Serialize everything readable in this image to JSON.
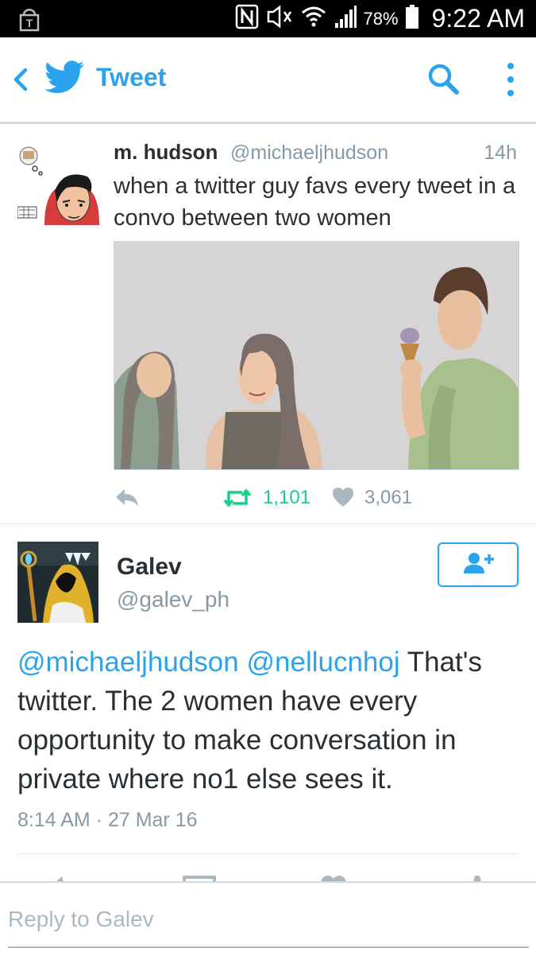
{
  "status_bar": {
    "battery_percent": "78%",
    "time": "9:22 AM",
    "icons": [
      "t-mobile-icon",
      "nfc-icon",
      "mute-icon",
      "wifi-icon",
      "signal-icon",
      "battery-icon"
    ]
  },
  "app_bar": {
    "title": "Tweet",
    "accent_color": "#2aa3ef",
    "icons": [
      "back-icon",
      "twitter-bird-icon",
      "search-icon",
      "more-icon"
    ]
  },
  "quoted_tweet": {
    "name": "m. hudson",
    "handle": "@michaeljhudson",
    "time": "14h",
    "text": "when a twitter guy favs every tweet in a convo between two women",
    "retweets": "1,101",
    "likes": "3,061",
    "retweet_color": "#19cf86"
  },
  "focused_tweet": {
    "name": "Galev",
    "handle": "@galev_ph",
    "mention1": "@michaeljhudson",
    "mention2": "@nellucnhoj",
    "body": " That's twitter. The 2 women have every opportunity to make conversation in private where no1 else sees it.",
    "timestamp": "8:14 AM · 27 Mar 16"
  },
  "reply_bar": {
    "placeholder": "Reply to Galev"
  }
}
